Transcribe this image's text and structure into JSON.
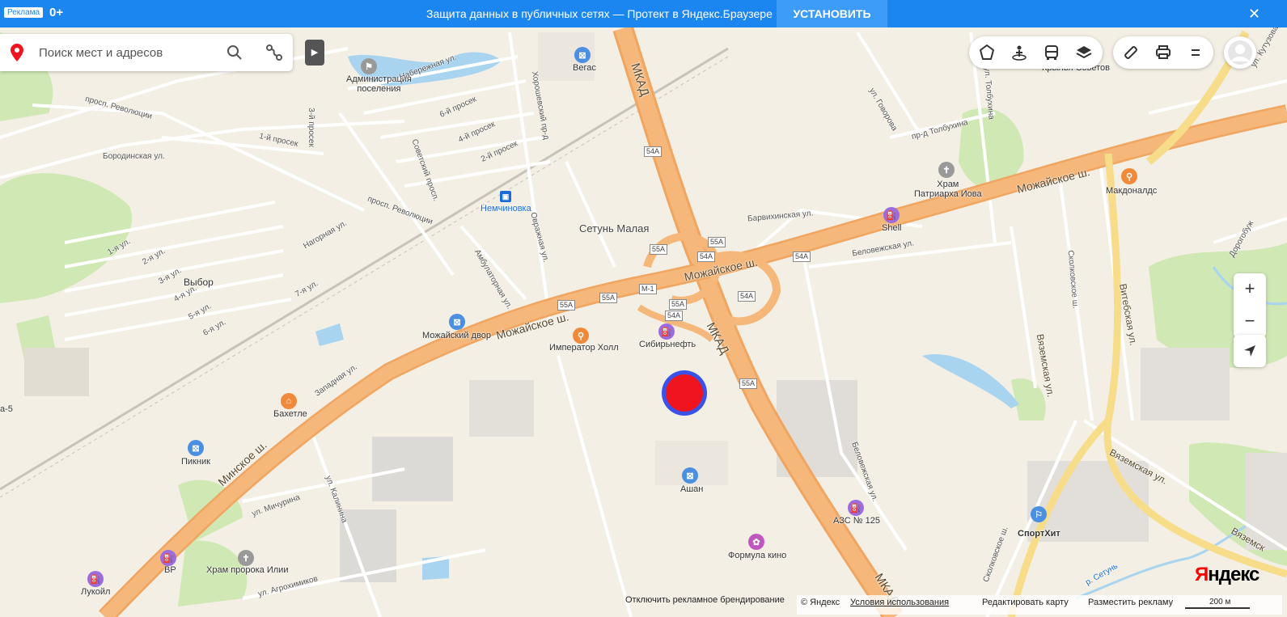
{
  "banner": {
    "ad_label": "Реклама",
    "age": "0+",
    "text": "Защита данных в публичных сетях — Протект в Яндекс.Браузере",
    "install": "УСТАНОВИТЬ",
    "close": "✕"
  },
  "search": {
    "placeholder": "Поиск мест и адресов"
  },
  "controls": {
    "icons": [
      "traffic-icon",
      "panorama-icon",
      "transit-icon",
      "layers-icon",
      "ruler-icon",
      "print-icon",
      "menu-icon"
    ]
  },
  "zoom": {
    "plus": "+",
    "minus": "−"
  },
  "labels": {
    "admin": "Администрация\nпоселения",
    "vegas": "Вегас",
    "naberezhnaya": "Набережная ул.",
    "pr_revolyutsii_1": "просп. Революции",
    "pr_revolyutsii_2": "просп. Революции",
    "prosek_1": "1-й просек",
    "prosek_2": "2-й просек",
    "prosek_3": "3-й просек",
    "prosek_4": "4-й просек",
    "prosek_6": "6-й просек",
    "sovetsky": "Советский просп.",
    "khoroshevsky": "Хорошевский пр-д",
    "borodinskaya": "Бородинская ул.",
    "nemchinovka": "Немчиновка",
    "setun_malaya": "Сетунь Малая",
    "ovrazhnaya": "Овражная ул.",
    "nagornaya": "Нагорная ул.",
    "vybor": "Выбор",
    "ul_1": "1-я ул.",
    "ul_2": "2-я ул.",
    "ul_3": "3-я ул.",
    "ul_4": "4-я ул.",
    "ul_5": "5-я ул.",
    "ul_6": "6-я ул.",
    "ul_7": "7-я ул.",
    "ambulatornaya": "Амбулаторная ул.",
    "mozhaisky_dvor": "Можайский двор",
    "imperator": "Император Холл",
    "sibneft": "Сибирьнефть",
    "mkad_1": "МКАД",
    "mkad_2": "МКАД",
    "mkad_3": "МКАД",
    "mozh_sh_1": "Можайское ш.",
    "mozh_sh_2": "Можайское ш.",
    "mozh_sh_3": "Можайское ш.",
    "minskoe": "Минское ш.",
    "zapadnaya": "Западная ул.",
    "bahetle": "Бахетле",
    "piknik": "Пикник",
    "ashan": "Ашан",
    "michurina": "ул. Мичурина",
    "kalinina": "ул. Калинина",
    "agrohimikov": "ул. Агрохимиков",
    "hram_ilii": "Храм пророка Илии",
    "bp": "BP",
    "lukoil": "Лукойл",
    "formula": "Формула кино",
    "azs125": "АЗС № 125",
    "belovezhskaya_1": "Беловежская ул.",
    "belovezhskaya_2": "Беловежская ул.",
    "barvikhinskaya": "Барвихинская ул.",
    "shell": "Shell",
    "hram_iova": "Храм\nПатриарха Иова",
    "mcdonalds": "Макдоналдс",
    "pr_tolbukhina": "пр-д Толбухина",
    "ul_govorova": "ул. Говорова",
    "ul_tolbukhina": "ул. Толбухина",
    "krylya": "Крылья Советов",
    "kutuzova": "ул. Кутузова",
    "skolkovskoe_1": "Сколковское ш.",
    "skolkovskoe_2": "Сколковское ш.",
    "vyazemskaya_1": "Вяземская ул.",
    "vyazemskaya_2": "Вяземская ул.",
    "vyazemskaya_3": "Вяземск",
    "vitebskaya": "Витебская ул.",
    "dorogobuzh": "Дорогобуж",
    "sporthit": "СпортХит",
    "setun_river": "р. Сетунь",
    "edge_5": "а-5"
  },
  "shields": {
    "s54a_1": "54А",
    "s54a_2": "54А",
    "s54a_3": "54А",
    "s54a_4": "54А",
    "s54a_5": "54А",
    "s54a_6": "54А",
    "s55a_1": "55А",
    "s55a_2": "55А",
    "s55a_3": "55А",
    "s55a_4": "55А",
    "s55a_5": "55А",
    "s55a_6": "55А",
    "m1": "M-1"
  },
  "footer": {
    "disable_branding": "Отключить рекламное брендирование",
    "copyright": "© Яндекс",
    "terms": "Условия использования",
    "edit_map": "Редактировать карту",
    "advertise": "Разместить рекламу",
    "scale": "200 м",
    "logo_y": "Я",
    "logo_rest": "ндекс"
  },
  "colors": {
    "banner": "#1b86f0",
    "highway": "#f5b77a",
    "water": "#a8d4f0",
    "park": "#cfe8b4",
    "marker_outer": "#3a52e8",
    "marker_inner": "#f0141e"
  }
}
